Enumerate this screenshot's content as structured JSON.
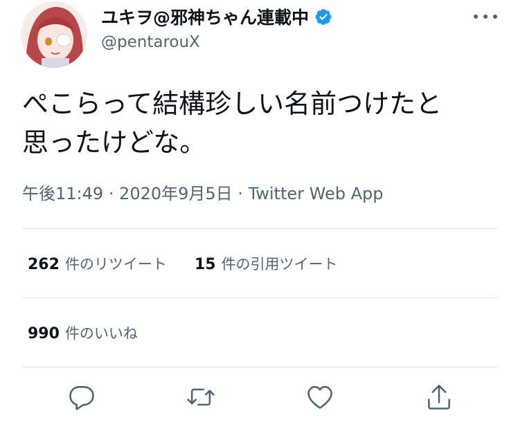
{
  "user": {
    "display_name": "ユキヲ@邪神ちゃん連載中",
    "handle": "@pentarouX",
    "verified": true
  },
  "tweet": {
    "text_line1": "ぺこらって結構珍しい名前つけたと",
    "text_line2": "思ったけどな。",
    "meta": "午後11:49 · 2020年9月5日 · Twitter Web App"
  },
  "stats": {
    "retweets_count": "262",
    "retweets_label": "件のリツイート",
    "quotes_count": "15",
    "quotes_label": "件の引用ツイート",
    "likes_count": "990",
    "likes_label": "件のいいね"
  },
  "actions": [
    {
      "icon": "reply-icon"
    },
    {
      "icon": "retweet-icon"
    },
    {
      "icon": "like-icon"
    },
    {
      "icon": "share-icon"
    }
  ],
  "colors": {
    "text": "#0f1419",
    "secondary": "#536471",
    "verified": "#1d9bf0",
    "divider": "#e1e6ea"
  }
}
